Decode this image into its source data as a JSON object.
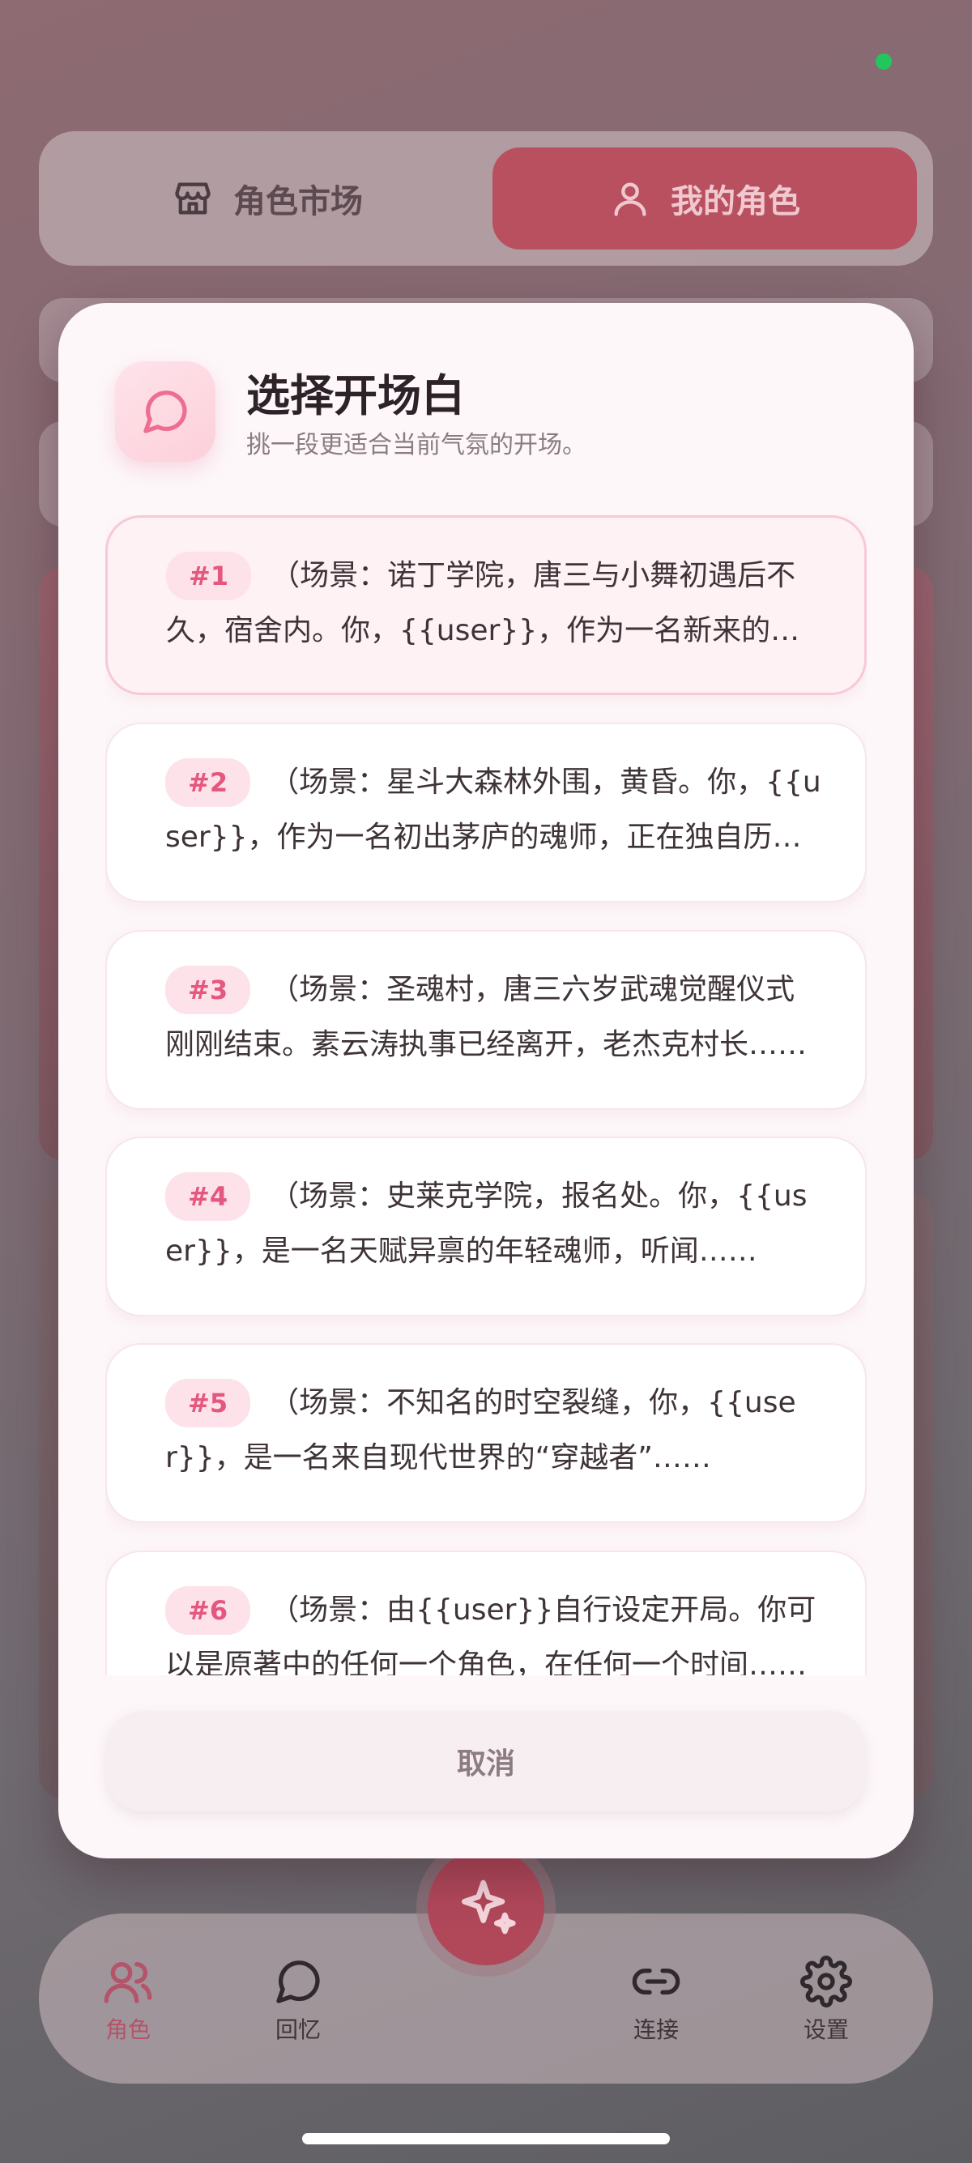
{
  "top_tabs": {
    "market_label": "角色市场",
    "mine_label": "我的角色"
  },
  "modal": {
    "title": "选择开场白",
    "subtitle": "挑一段更适合当前气氛的开场。",
    "options": [
      {
        "badge": "#1",
        "text": "（场景：诺丁学院，唐三与小舞初遇后不久，宿舍内。你，{{user}}，作为一名新来的学员……",
        "selected": true
      },
      {
        "badge": "#2",
        "text": "（场景：星斗大森林外围，黄昏。你，{{user}}，作为一名初出茅庐的魂师，正在独自历练……",
        "selected": false
      },
      {
        "badge": "#3",
        "text": "（场景：圣魂村，唐三六岁武魂觉醒仪式刚刚结束。素云涛执事已经离开，老杰克村长……",
        "selected": false
      },
      {
        "badge": "#4",
        "text": "（场景：史莱克学院，报名处。你，{{user}}，是一名天赋异禀的年轻魂师，听闻……",
        "selected": false
      },
      {
        "badge": "#5",
        "text": "（场景：不知名的时空裂缝，你，{{user}}，是一名来自现代世界的“穿越者”……",
        "selected": false
      },
      {
        "badge": "#6",
        "text": "（场景：由{{user}}自行设定开局。你可以是原著中的任何一个角色，在任何一个时间……",
        "selected": false
      }
    ],
    "cancel_label": "取消"
  },
  "bottom_nav": {
    "items": [
      {
        "label": "角色",
        "icon": "users-icon",
        "active": true
      },
      {
        "label": "回忆",
        "icon": "chat-bubble-icon",
        "active": false
      },
      {
        "label": "连接",
        "icon": "link-icon",
        "active": false
      },
      {
        "label": "设置",
        "icon": "gear-icon",
        "active": false
      }
    ],
    "fab_icon": "sparkles-icon"
  },
  "colors": {
    "accent_pink": "#e4577e",
    "badge_bg": "#fde2ea",
    "status_dot": "#23c55e",
    "active_tab": "#b9505f"
  }
}
